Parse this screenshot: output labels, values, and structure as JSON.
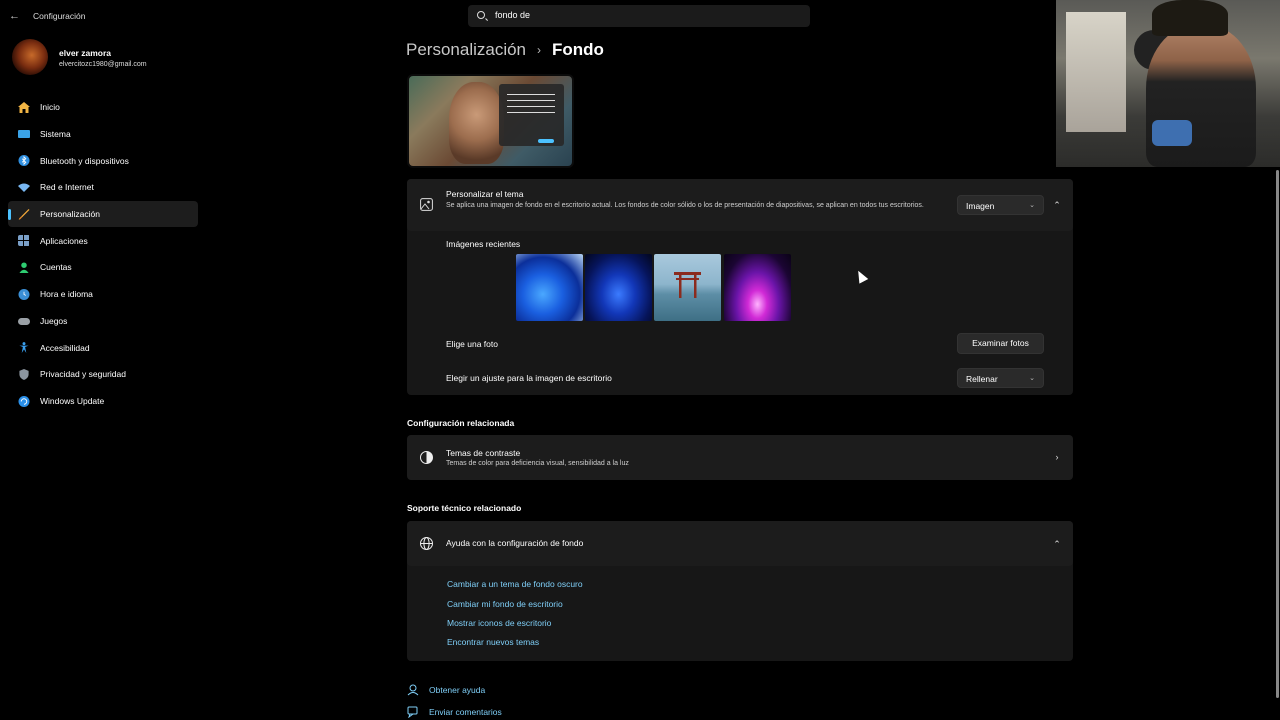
{
  "app": {
    "title": "Configuración",
    "back": "←"
  },
  "search": {
    "value": "fondo de"
  },
  "user": {
    "name": "elver zamora",
    "email": "elvercitozc1980@gmail.com"
  },
  "sidebar": {
    "items": [
      {
        "label": "Inicio",
        "icon": "home-icon",
        "color": "#f2b544"
      },
      {
        "label": "Sistema",
        "icon": "monitor-icon",
        "color": "#3aa3e8"
      },
      {
        "label": "Bluetooth y dispositivos",
        "icon": "bluetooth-icon",
        "color": "#2f8fe0"
      },
      {
        "label": "Red e Internet",
        "icon": "wifi-icon",
        "color": "#78b7f2"
      },
      {
        "label": "Personalización",
        "icon": "brush-icon",
        "color": "#f2a93b",
        "active": true
      },
      {
        "label": "Aplicaciones",
        "icon": "apps-icon",
        "color": "#7a9fc8"
      },
      {
        "label": "Cuentas",
        "icon": "person-icon",
        "color": "#2ecc71"
      },
      {
        "label": "Hora e idioma",
        "icon": "globe-clock-icon",
        "color": "#3a8fd6"
      },
      {
        "label": "Juegos",
        "icon": "gamepad-icon",
        "color": "#9aa0a6"
      },
      {
        "label": "Accesibilidad",
        "icon": "accessibility-icon",
        "color": "#3aa0f0"
      },
      {
        "label": "Privacidad y seguridad",
        "icon": "shield-icon",
        "color": "#8c96a0"
      },
      {
        "label": "Windows Update",
        "icon": "update-icon",
        "color": "#2a8fe8"
      }
    ]
  },
  "breadcrumb": {
    "parent": "Personalización",
    "separator": "›",
    "current": "Fondo"
  },
  "personalize": {
    "title": "Personalizar el tema",
    "description": "Se aplica una imagen de fondo en el escritorio actual. Los fondos de color sólido o los de presentación de diapositivas, se aplican en todos tus escritorios.",
    "dropdown_value": "Imagen",
    "recent_label": "Imágenes recientes",
    "choose_photo_label": "Elige una foto",
    "browse_button": "Examinar fotos",
    "fit_label": "Elegir un ajuste para la imagen de escritorio",
    "fit_value": "Rellenar"
  },
  "related": {
    "section_title": "Configuración relacionada",
    "contrast_title": "Temas de contraste",
    "contrast_desc": "Temas de color para deficiencia visual, sensibilidad a la luz"
  },
  "support": {
    "section_title": "Soporte técnico relacionado",
    "help_title": "Ayuda con la configuración de fondo",
    "links": [
      "Cambiar a un tema de fondo oscuro",
      "Cambiar mi fondo de escritorio",
      "Mostrar iconos de escritorio",
      "Encontrar nuevos temas"
    ]
  },
  "footer": {
    "help": "Obtener ayuda",
    "feedback": "Enviar comentarios"
  },
  "colors": {
    "accent": "#4cc2ff",
    "link": "#7fcff8",
    "card": "#171717",
    "background": "#000000"
  }
}
